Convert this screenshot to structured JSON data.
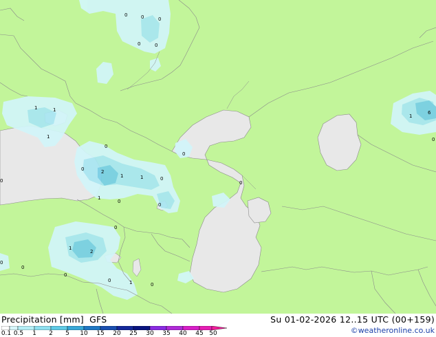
{
  "footer": {
    "title": "Precipitation [mm]  GFS",
    "datetime": "Su 01-02-2026 12..15 UTC (00+159)",
    "credit": "©weatheronline.co.uk"
  },
  "legend": {
    "ticks": [
      "0.1",
      "0.5",
      "1",
      "2",
      "5",
      "10",
      "15",
      "20",
      "25",
      "30",
      "35",
      "40",
      "45",
      "50"
    ],
    "colors": [
      "#ffffff",
      "#d8f7fb",
      "#b4eef6",
      "#8ee0f0",
      "#5fcbe6",
      "#38a8d8",
      "#1f78c4",
      "#1a4fb0",
      "#14289a",
      "#0a1480",
      "#8a2be2",
      "#b02ad8",
      "#d81ec8",
      "#e61eb4",
      "#f01e9a"
    ]
  },
  "map": {
    "land_color": "#c2f59a",
    "water_color": "#e8e8e8",
    "precip_light": "#d2f6fa",
    "precip_mid": "#a8e6f2",
    "precip_dark": "#78cfe6",
    "labels": [
      {
        "text": "0"
      },
      {
        "text": "0"
      },
      {
        "text": "0"
      },
      {
        "text": "0"
      },
      {
        "text": "0"
      },
      {
        "text": "1"
      },
      {
        "text": "1"
      },
      {
        "text": "1"
      },
      {
        "text": "0"
      },
      {
        "text": "0"
      },
      {
        "text": "2"
      },
      {
        "text": "1"
      },
      {
        "text": "1"
      },
      {
        "text": "0"
      },
      {
        "text": "1"
      },
      {
        "text": "0"
      },
      {
        "text": "0"
      },
      {
        "text": "0"
      },
      {
        "text": "0"
      },
      {
        "text": "0"
      },
      {
        "text": "1"
      },
      {
        "text": "2"
      },
      {
        "text": "0"
      },
      {
        "text": "0"
      },
      {
        "text": "0"
      },
      {
        "text": "0"
      },
      {
        "text": "1"
      },
      {
        "text": "0"
      },
      {
        "text": "0"
      },
      {
        "text": "1"
      },
      {
        "text": "6"
      },
      {
        "text": "0"
      }
    ]
  }
}
